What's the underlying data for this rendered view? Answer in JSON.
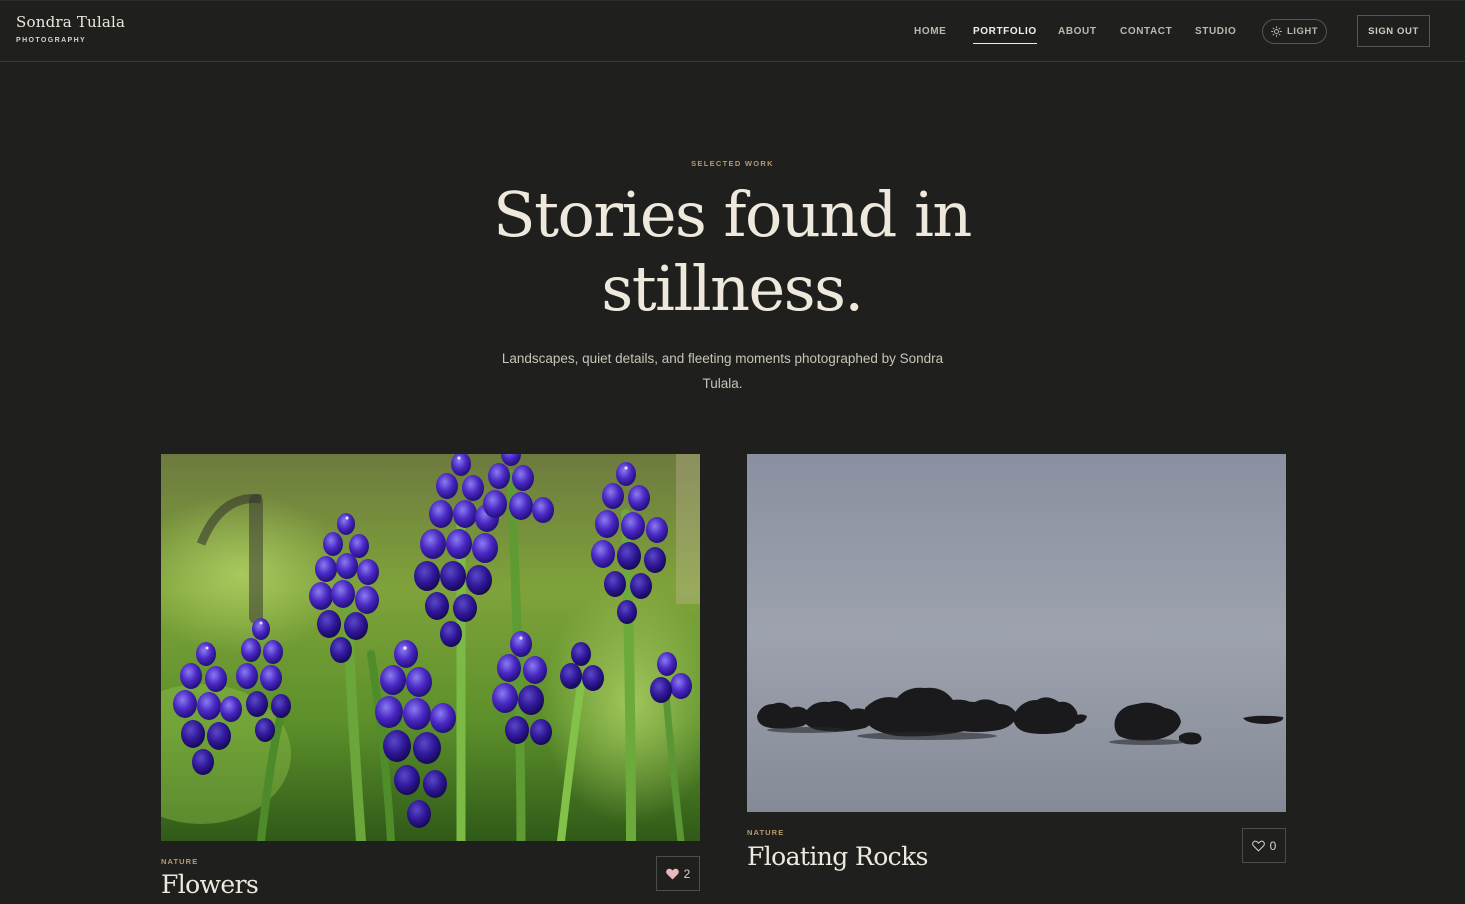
{
  "brand": {
    "name": "Sondra Tulala",
    "tagline": "PHOTOGRAPHY"
  },
  "nav": {
    "items": [
      {
        "label": "HOME",
        "active": false
      },
      {
        "label": "PORTFOLIO",
        "active": true
      },
      {
        "label": "ABOUT",
        "active": false
      },
      {
        "label": "CONTACT",
        "active": false
      },
      {
        "label": "STUDIO",
        "active": false
      }
    ],
    "theme_toggle": {
      "label": "LIGHT",
      "icon": "sun-icon"
    },
    "sign_out_label": "SIGN OUT"
  },
  "hero": {
    "eyebrow": "SELECTED WORK",
    "title_line1": "Stories found in",
    "title_line2": "stillness.",
    "subtitle": "Landscapes, quiet details, and fleeting moments photographed by Sondra Tulala."
  },
  "gallery": {
    "items": [
      {
        "category": "NATURE",
        "title": "Flowers",
        "likes": "2",
        "liked": true,
        "icon": "heart-icon",
        "photo": "grape-hyacinth-flowers"
      },
      {
        "category": "NATURE",
        "title": "Floating Rocks",
        "likes": "0",
        "liked": false,
        "icon": "heart-icon",
        "photo": "rocks-in-misty-water"
      }
    ]
  },
  "colors": {
    "background": "#1f201d",
    "text": "#efe9dd",
    "accent": "#b79a6f",
    "liked_heart": "#e8b8bd",
    "border": "#4d4e48"
  }
}
